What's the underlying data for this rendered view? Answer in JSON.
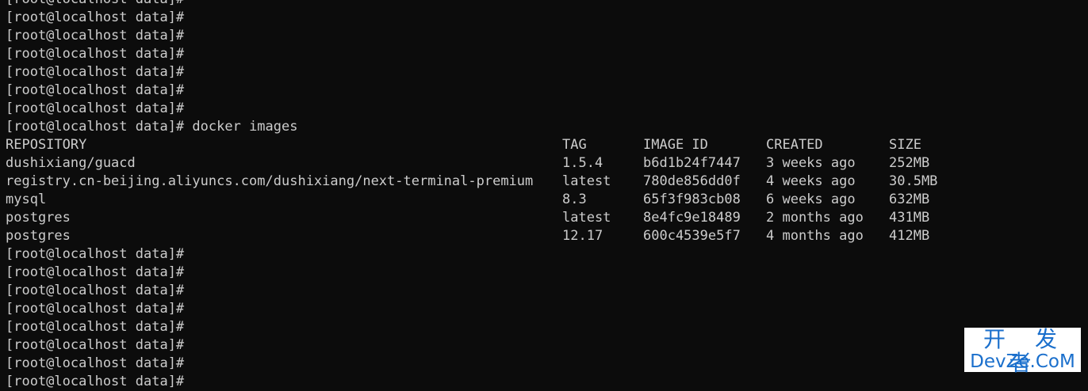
{
  "prompt": "[root@localhost data]#",
  "command": "docker images",
  "prompts_before": 7,
  "prompts_after": 8,
  "table": {
    "headers": {
      "repository": "REPOSITORY",
      "tag": "TAG",
      "image_id": "IMAGE ID",
      "created": "CREATED",
      "size": "SIZE"
    },
    "rows": [
      {
        "repository": "dushixiang/guacd",
        "tag": "1.5.4",
        "image_id": "b6d1b24f7447",
        "created": "3 weeks ago",
        "size": "252MB"
      },
      {
        "repository": "registry.cn-beijing.aliyuncs.com/dushixiang/next-terminal-premium",
        "tag": "latest",
        "image_id": "780de856dd0f",
        "created": "4 weeks ago",
        "size": "30.5MB"
      },
      {
        "repository": "mysql",
        "tag": "8.3",
        "image_id": "65f3f983cb08",
        "created": "6 weeks ago",
        "size": "632MB"
      },
      {
        "repository": "postgres",
        "tag": "latest",
        "image_id": "8e4fc9e18489",
        "created": "2 months ago",
        "size": "431MB"
      },
      {
        "repository": "postgres",
        "tag": "12.17",
        "image_id": "600c4539e5f7",
        "created": "4 months ago",
        "size": "412MB"
      }
    ]
  },
  "watermark": {
    "line1": "开 发 者",
    "line2": "DevZe.CoM"
  },
  "colors": {
    "background": "#0c0c0c",
    "foreground": "#cccccc",
    "watermark": "#1a6fcc"
  }
}
